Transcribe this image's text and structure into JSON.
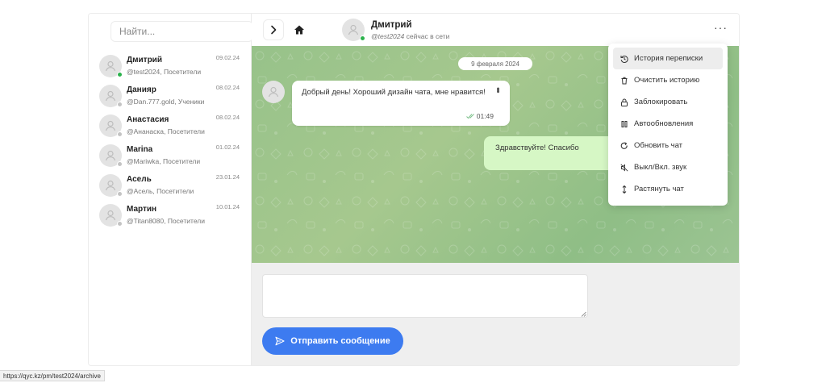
{
  "sidebar": {
    "search_placeholder": "Найти...",
    "contacts": [
      {
        "name": "Дмитрий",
        "sub": "@test2024, Посетители",
        "date": "09.02.24",
        "online": true
      },
      {
        "name": "Данияр",
        "sub": "@Dan.777.gold, Ученики",
        "date": "08.02.24",
        "online": false
      },
      {
        "name": "Анастасия",
        "sub": "@Ананаска, Посетители",
        "date": "08.02.24",
        "online": false
      },
      {
        "name": "Marina",
        "sub": "@Mariwka, Посетители",
        "date": "01.02.24",
        "online": false
      },
      {
        "name": "Асель",
        "sub": "@Асель, Посетители",
        "date": "23.01.24",
        "online": false
      },
      {
        "name": "Мартин",
        "sub": "@Titan8080, Посетители",
        "date": "10.01.24",
        "online": false
      }
    ]
  },
  "header": {
    "name": "Дмитрий",
    "handle": "@test2024",
    "status": " сейчас в сети",
    "more": "···"
  },
  "chat": {
    "date_pill": "9 февраля 2024",
    "incoming": {
      "text": "Добрый день! Хороший дизайн чата, мне нравится!",
      "time": "01:49"
    },
    "outgoing": {
      "text": "Здравствуйте! Спасибо"
    }
  },
  "composer": {
    "placeholder": "",
    "send_label": "Отправить сообщение"
  },
  "menu": {
    "items": [
      {
        "label": "История переписки",
        "icon": "history-icon"
      },
      {
        "label": "Очистить историю",
        "icon": "trash-icon"
      },
      {
        "label": "Заблокировать",
        "icon": "lock-icon"
      },
      {
        "label": "Автообновления",
        "icon": "pause-icon"
      },
      {
        "label": "Обновить чат",
        "icon": "refresh-icon"
      },
      {
        "label": "Выкл/Вкл. звук",
        "icon": "mute-icon"
      },
      {
        "label": "Растянуть чат",
        "icon": "expand-icon"
      }
    ]
  },
  "status_bar": {
    "url": "https://qyc.kz/pm/test2024/archive"
  },
  "colors": {
    "accent": "#3d7bf0",
    "online": "#2bb24c",
    "offline": "#c4c4c4",
    "outgoing_bubble": "#d6f7c5"
  }
}
